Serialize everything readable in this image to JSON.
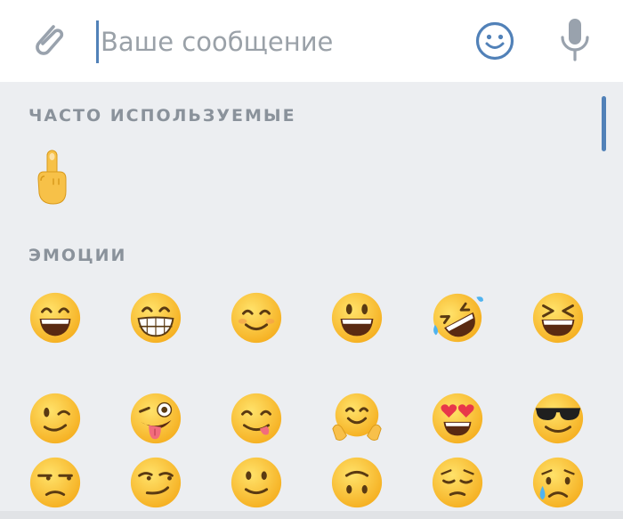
{
  "input_bar": {
    "placeholder": "Ваше сообщение",
    "value": "",
    "attach_icon": "paperclip-icon",
    "emoji_icon": "smiley-icon",
    "mic_icon": "microphone-icon",
    "accent_color": "#5181b8",
    "icon_color": "#99a2ad"
  },
  "emoji_panel": {
    "sections": [
      {
        "title": "ЧАСТО ИСПОЛЬЗУЕМЫЕ",
        "emojis": [
          {
            "name": "middle-finger",
            "char": "🖕"
          }
        ]
      },
      {
        "title": "ЭМОЦИИ",
        "emojis": [
          {
            "name": "grinning-smiling-eyes",
            "char": "😄"
          },
          {
            "name": "beaming-face",
            "char": "😁"
          },
          {
            "name": "smiling-face",
            "char": "😊"
          },
          {
            "name": "grinning-big-eyes",
            "char": "😃"
          },
          {
            "name": "rolling-laughing",
            "char": "🤣"
          },
          {
            "name": "grinning-squinting",
            "char": "😆"
          },
          {
            "name": "winking-face",
            "char": "😉"
          },
          {
            "name": "zany-tongue-wink",
            "char": "😜"
          },
          {
            "name": "savoring-food",
            "char": "😋"
          },
          {
            "name": "hugging-face",
            "char": "🤗"
          },
          {
            "name": "heart-eyes",
            "char": "😍"
          },
          {
            "name": "sunglasses-face",
            "char": "😎"
          },
          {
            "name": "unamused-face",
            "char": "😒"
          },
          {
            "name": "smirking-face",
            "char": "😏"
          },
          {
            "name": "slightly-smiling",
            "char": "🙂"
          },
          {
            "name": "upside-down-face",
            "char": "🙃"
          },
          {
            "name": "pensive-face",
            "char": "😔"
          },
          {
            "name": "crying-face",
            "char": "😢"
          }
        ]
      }
    ],
    "scrollbar_color": "#5181b8"
  }
}
